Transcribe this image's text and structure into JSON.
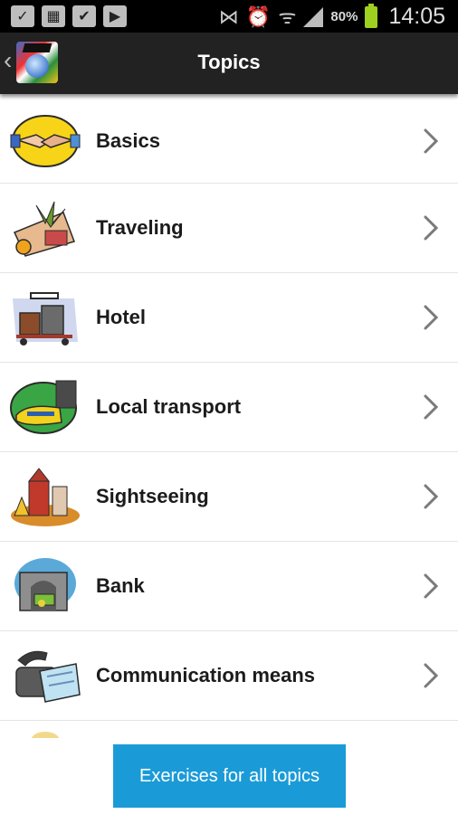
{
  "status_bar": {
    "battery_percent": "80%",
    "time": "14:05",
    "left_icons": [
      "notification-check-icon",
      "image-icon",
      "briefcase-check-icon",
      "play-store-icon"
    ],
    "right_icons": [
      "vibrate-icon",
      "alarm-icon",
      "wifi-icon",
      "signal-icon",
      "battery-icon"
    ],
    "battery_color": "#9ed020"
  },
  "action_bar": {
    "title": "Topics",
    "back_glyph": "‹",
    "app_icon": "app-logo-icon"
  },
  "topics": [
    {
      "label": "Basics",
      "icon": "handshake-icon"
    },
    {
      "label": "Traveling",
      "icon": "travel-icon"
    },
    {
      "label": "Hotel",
      "icon": "luggage-cart-icon"
    },
    {
      "label": "Local transport",
      "icon": "train-icon"
    },
    {
      "label": "Sightseeing",
      "icon": "landmark-icon"
    },
    {
      "label": "Bank",
      "icon": "bank-icon"
    },
    {
      "label": "Communication means",
      "icon": "telephone-icon"
    }
  ],
  "footer": {
    "button_label": "Exercises for all topics",
    "button_color": "#1a9bd7"
  }
}
